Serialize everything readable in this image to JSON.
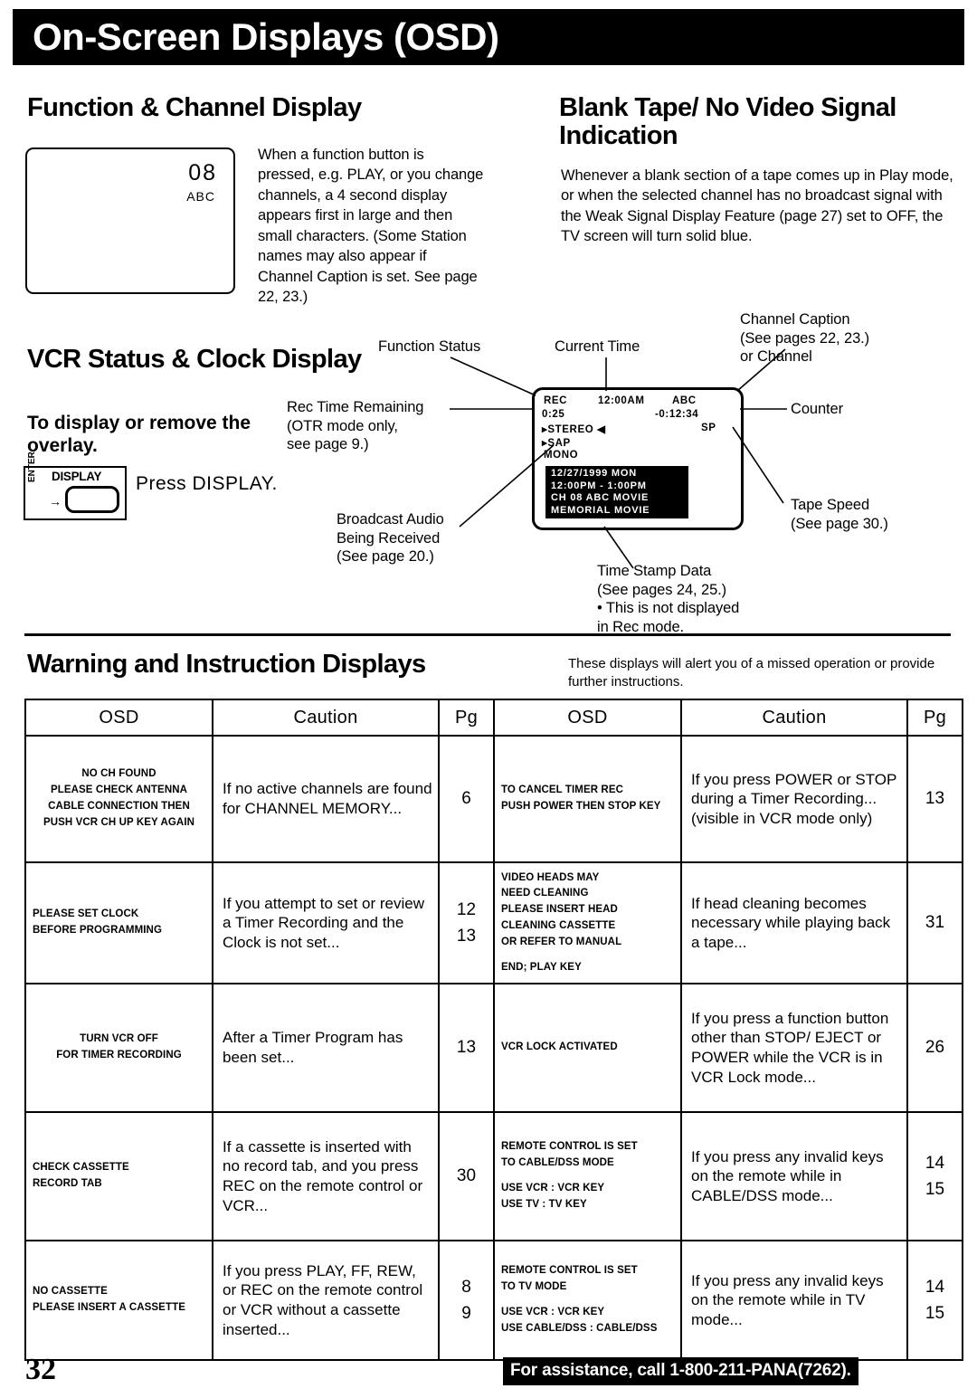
{
  "header": {
    "title": "On-Screen Displays (OSD)"
  },
  "function_channel": {
    "heading": "Function & Channel Display",
    "tv_preview": {
      "channel": "08",
      "station": "ABC"
    },
    "description": "When a function button is pressed, e.g. PLAY, or you change channels, a 4 second display appears first in large and then small characters. (Some Station names may also appear if Channel Caption is set. See page 22, 23.)"
  },
  "blank_tape": {
    "heading": "Blank Tape/ No Video Signal Indication",
    "description": "Whenever a blank section of a tape comes up in Play mode, or when the selected channel has no broadcast signal with the Weak Signal Display Feature (page 27) set to OFF, the TV screen will turn solid blue."
  },
  "vcr_status": {
    "heading": "VCR Status & Clock Display",
    "subheading": "To display or remove the overlay.",
    "button": {
      "label": "DISPLAY",
      "secondary_label": "ENTER",
      "arrow": "→"
    },
    "instruction": "Press DISPLAY."
  },
  "osd_screen": {
    "function_status": "REC",
    "current_time": "12:00AM",
    "channel_caption": "ABC",
    "rec_time_remaining": "0:25",
    "counter": "-0:12:34",
    "audio_stereo": "STEREO",
    "audio_sap": "SAP",
    "audio_mono": "MONO",
    "tape_speed": "SP",
    "time_stamp": [
      "12/27/1999 MON",
      "12:00PM -  1:00PM",
      "CH 08 ABC  MOVIE",
      "MEMORIAL MOVIE"
    ]
  },
  "callouts": {
    "function_status": "Function Status",
    "current_time": "Current Time",
    "channel_caption": "Channel Caption\n(See pages 22, 23.)\nor Channel",
    "rec_time_remaining": "Rec Time Remaining\n(OTR mode only,\nsee page 9.)",
    "counter": "Counter",
    "tape_speed": "Tape Speed\n(See page 30.)",
    "broadcast_audio": "Broadcast Audio\nBeing Received\n(See page 20.)",
    "time_stamp": "Time Stamp Data\n(See pages 24, 25.)\n• This is not displayed\n   in Rec mode."
  },
  "warning_section": {
    "heading": "Warning and Instruction Displays",
    "note": "These displays will alert you of a missed operation or provide further instructions.",
    "columns": [
      "OSD",
      "Caution",
      "Pg",
      "OSD",
      "Caution",
      "Pg"
    ],
    "rows": [
      {
        "left": {
          "osd": [
            "NO CH FOUND",
            "PLEASE CHECK ANTENNA",
            "CABLE CONNECTION THEN",
            "PUSH VCR CH UP KEY AGAIN"
          ],
          "caution": "If no active channels are found for CHANNEL MEMORY...",
          "pg": "6"
        },
        "right": {
          "osd": [
            "TO CANCEL TIMER REC",
            "PUSH POWER THEN STOP KEY"
          ],
          "osd_align": "left",
          "caution": "If you press POWER or STOP during a Timer Recording...\n(visible in VCR mode only)",
          "pg": "13"
        }
      },
      {
        "left": {
          "osd": [
            "PLEASE SET CLOCK",
            "BEFORE PROGRAMMING"
          ],
          "osd_align": "left",
          "caution": "If you attempt to set or review a Timer Recording and the Clock is not set...",
          "pg": "12\n13"
        },
        "right": {
          "osd": [
            "VIDEO HEADS MAY",
            "NEED CLEANING",
            "PLEASE INSERT HEAD",
            "CLEANING CASSETTE",
            "OR REFER TO MANUAL",
            "",
            "END; PLAY KEY"
          ],
          "osd_align": "left",
          "caution": "If head cleaning becomes necessary while playing back a tape...",
          "pg": "31"
        }
      },
      {
        "left": {
          "osd": [
            "TURN VCR OFF",
            "FOR TIMER RECORDING"
          ],
          "caution": "After a Timer Program has been set...",
          "pg": "13"
        },
        "right": {
          "osd": [
            "VCR LOCK ACTIVATED"
          ],
          "osd_align": "left",
          "caution": "If you press a function button other than STOP/ EJECT or POWER while the VCR is in VCR Lock mode...",
          "pg": "26"
        }
      },
      {
        "left": {
          "osd": [
            "CHECK CASSETTE",
            "RECORD TAB"
          ],
          "osd_align": "left",
          "caution": "If a cassette is inserted with no record tab, and you press REC on the remote control or VCR...",
          "pg": "30"
        },
        "right": {
          "osd": [
            "REMOTE CONTROL IS SET",
            "TO CABLE/DSS MODE",
            "",
            "USE VCR :  VCR KEY",
            "USE TV   :  TV KEY"
          ],
          "osd_align": "left",
          "caution": "If you press any invalid keys on the remote while in CABLE/DSS mode...",
          "pg": "14\n15"
        }
      },
      {
        "left": {
          "osd": [
            "NO CASSETTE",
            "PLEASE INSERT A CASSETTE"
          ],
          "osd_align": "left",
          "caution": "If you press PLAY, FF, REW, or REC on the remote control or VCR without a cassette inserted...",
          "pg": "8\n9"
        },
        "right": {
          "osd": [
            "REMOTE CONTROL IS SET",
            "TO TV MODE",
            "",
            "USE VCR : VCR KEY",
            "USE CABLE/DSS : CABLE/DSS"
          ],
          "osd_align": "left",
          "caution": "If you press any invalid keys on the remote while in TV mode...",
          "pg": "14\n15"
        }
      }
    ]
  },
  "footer": {
    "page_number": "32",
    "assistance": "For assistance, call 1-800-211-PANA(7262)."
  }
}
